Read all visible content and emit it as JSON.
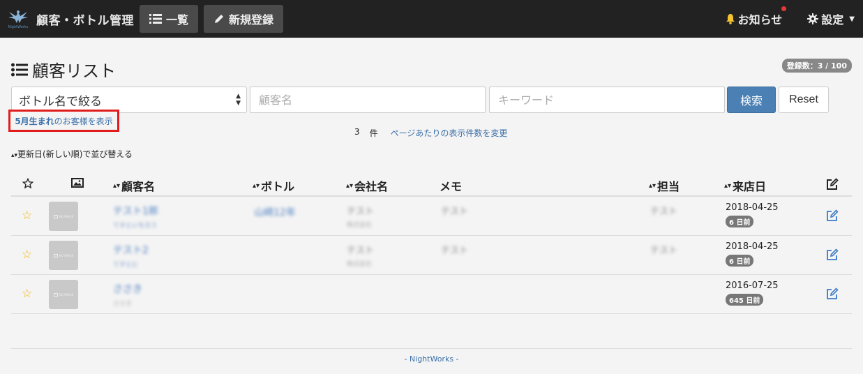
{
  "navbar": {
    "logo_text": "NightWorks",
    "brand": "顧客・ボトル管理",
    "list_button": "一覧",
    "new_button": "新規登録",
    "notice": "お知らせ",
    "settings": "設定"
  },
  "page": {
    "title": "顧客リスト",
    "count_badge": "登録数：3 / 100"
  },
  "search": {
    "bottle_select": "ボトル名で絞る",
    "customer_placeholder": "顧客名",
    "keyword_placeholder": "キーワード",
    "search_button": "検索",
    "reset_button": "Reset"
  },
  "filters": {
    "birth_month_strong": "5月生まれ",
    "birth_month_rest": "のお客様を表示",
    "result_count": "3",
    "result_unit": "件",
    "per_page_link": "ページあたりの表示件数を変更",
    "sort_label": "更新日(新しい順)で並び替える"
  },
  "table": {
    "headers": {
      "customer": "顧客名",
      "bottle": "ボトル",
      "company": "会社名",
      "memo": "メモ",
      "staff": "担当",
      "visit": "来店日"
    },
    "rows": [
      {
        "thumb": "NO IMAGE",
        "name": "テスト1郎",
        "kana": "てすといちろう",
        "bottle": "山崎12年",
        "company": "テスト",
        "company_sub": "株式会社",
        "memo": "テスト",
        "staff": "テスト",
        "date": "2018-04-25",
        "days": "6 日前"
      },
      {
        "thumb": "NO IMAGE",
        "name": "テスト2",
        "kana": "てすとに",
        "bottle": "",
        "company": "テスト",
        "company_sub": "株式会社",
        "memo": "テスト",
        "staff": "テスト",
        "date": "2018-04-25",
        "days": "6 日前"
      },
      {
        "thumb": "NO IMAGE",
        "name": "ささき",
        "kana": "ささき",
        "bottle": "",
        "company": "",
        "company_sub": "",
        "memo": "",
        "staff": "",
        "date": "2016-07-25",
        "days": "645 日前"
      }
    ]
  },
  "footer": "- NightWorks -"
}
